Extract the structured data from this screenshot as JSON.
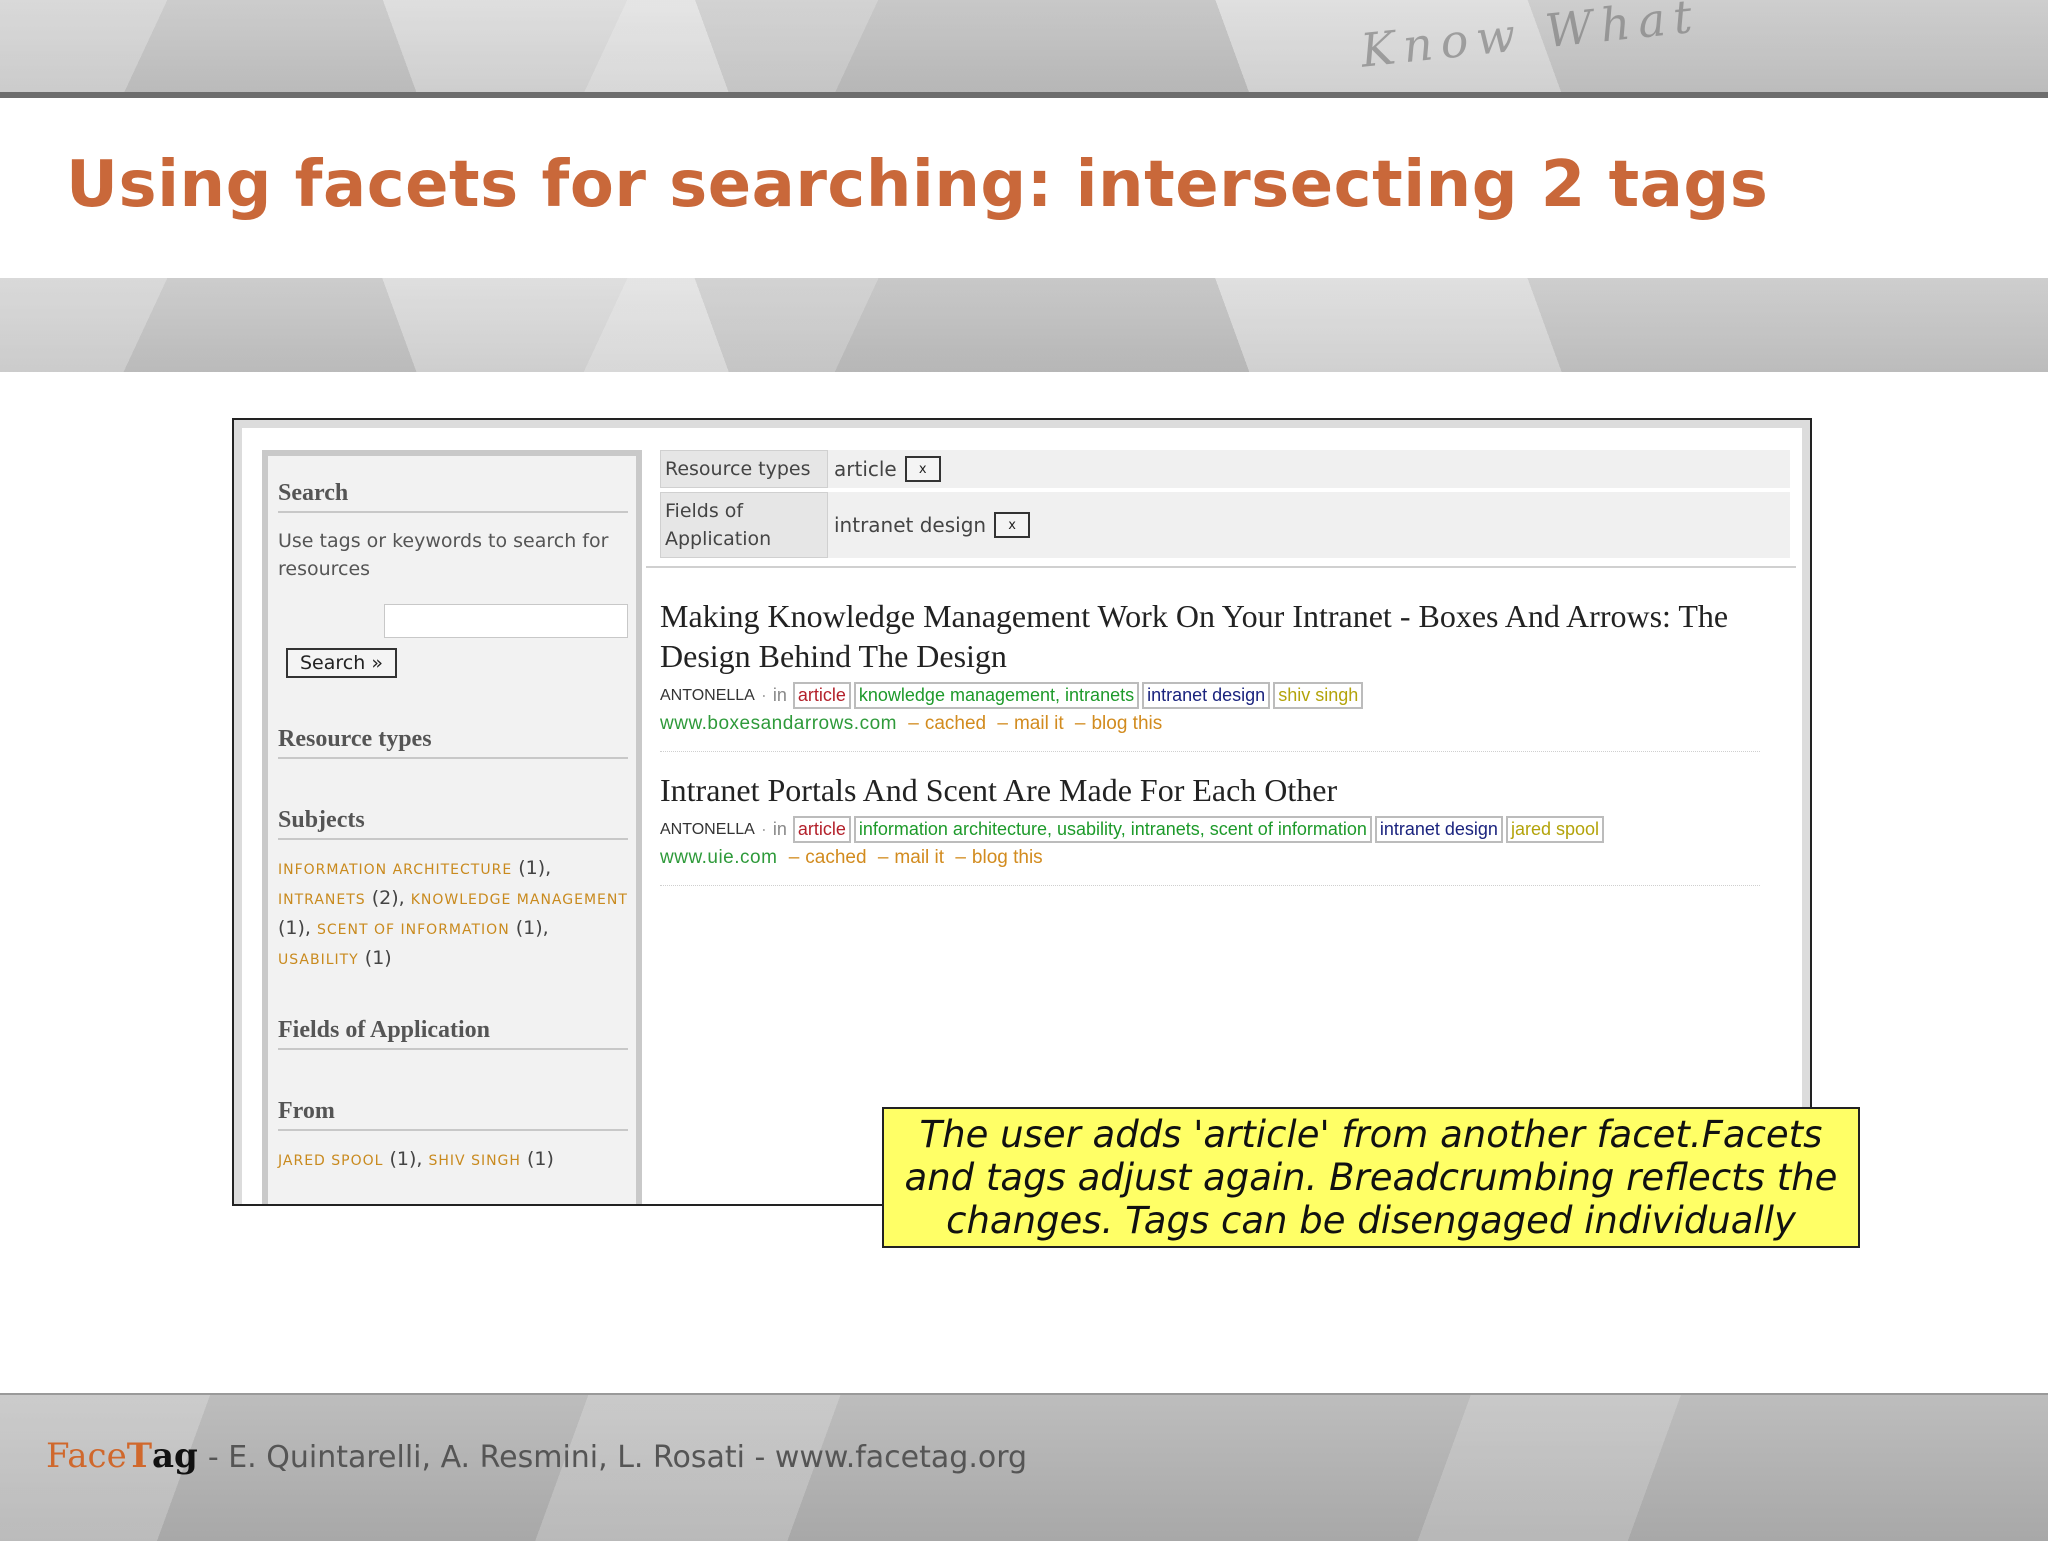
{
  "slide": {
    "title": "Using facets for searching: intersecting 2 tags",
    "title_color": "#c9683a",
    "scribble": "Know What"
  },
  "sidebar": {
    "search": {
      "heading": "Search",
      "description": "Use tags or keywords to search for resources",
      "input_value": "",
      "button_label": "Search »"
    },
    "resource_types": {
      "heading": "Resource types"
    },
    "subjects": {
      "heading": "Subjects",
      "items": [
        {
          "label": "information architecture",
          "count": "(1)"
        },
        {
          "label": "intranets",
          "count": "(2)"
        },
        {
          "label": "knowledge management",
          "count": "(1)"
        },
        {
          "label": "scent of information",
          "count": "(1)"
        },
        {
          "label": "usability",
          "count": "(1)"
        }
      ]
    },
    "fields": {
      "heading": "Fields of Application"
    },
    "from": {
      "heading": "From",
      "items": [
        {
          "label": "jared spool",
          "count": "(1)"
        },
        {
          "label": "shiv singh",
          "count": "(1)"
        }
      ]
    }
  },
  "breadcrumbs": [
    {
      "label": "Resource types",
      "value": "article",
      "remove": "x"
    },
    {
      "label": "Fields of Application",
      "value": "intranet design",
      "remove": "x"
    }
  ],
  "results": [
    {
      "title": "Making Knowledge Management Work On Your Intranet - Boxes And Arrows: The Design Behind The Design",
      "user": "ANTONELLA",
      "bullet": "·",
      "in": "in",
      "tags": {
        "type": "article",
        "subjects": [
          "knowledge management",
          "intranets"
        ],
        "field": "intranet design",
        "author": "shiv singh"
      },
      "url": "www.boxesandarrows.com",
      "actions": [
        "cached",
        "mail it",
        "blog this"
      ]
    },
    {
      "title": "Intranet Portals And Scent Are Made For Each Other",
      "user": "ANTONELLA",
      "bullet": "·",
      "in": "in",
      "tags": {
        "type": "article",
        "subjects": [
          "information architecture",
          "usability",
          "intranets",
          "scent of information"
        ],
        "field": "intranet design",
        "author": "jared spool"
      },
      "url": "www.uie.com",
      "actions": [
        "cached",
        "mail it",
        "blog this"
      ]
    }
  ],
  "callout": {
    "text": "The user adds 'article' from another facet.Facets and tags adjust again. Breadcrumbing reflects the changes. Tags can be disengaged individually",
    "background": "#ffff66"
  },
  "footer": {
    "brand_face": "Face",
    "brand_t": "T",
    "brand_ag": "ag",
    "text": "- E. Quintarelli, A. Resmini, L. Rosati - www.facetag.org"
  },
  "colors": {
    "tag_type": "#b3202a",
    "tag_subject": "#1d9a2a",
    "tag_field": "#1a237e",
    "tag_author": "#b3a30a",
    "link_url": "#2e9a3a",
    "link_action": "#d28b1e"
  }
}
